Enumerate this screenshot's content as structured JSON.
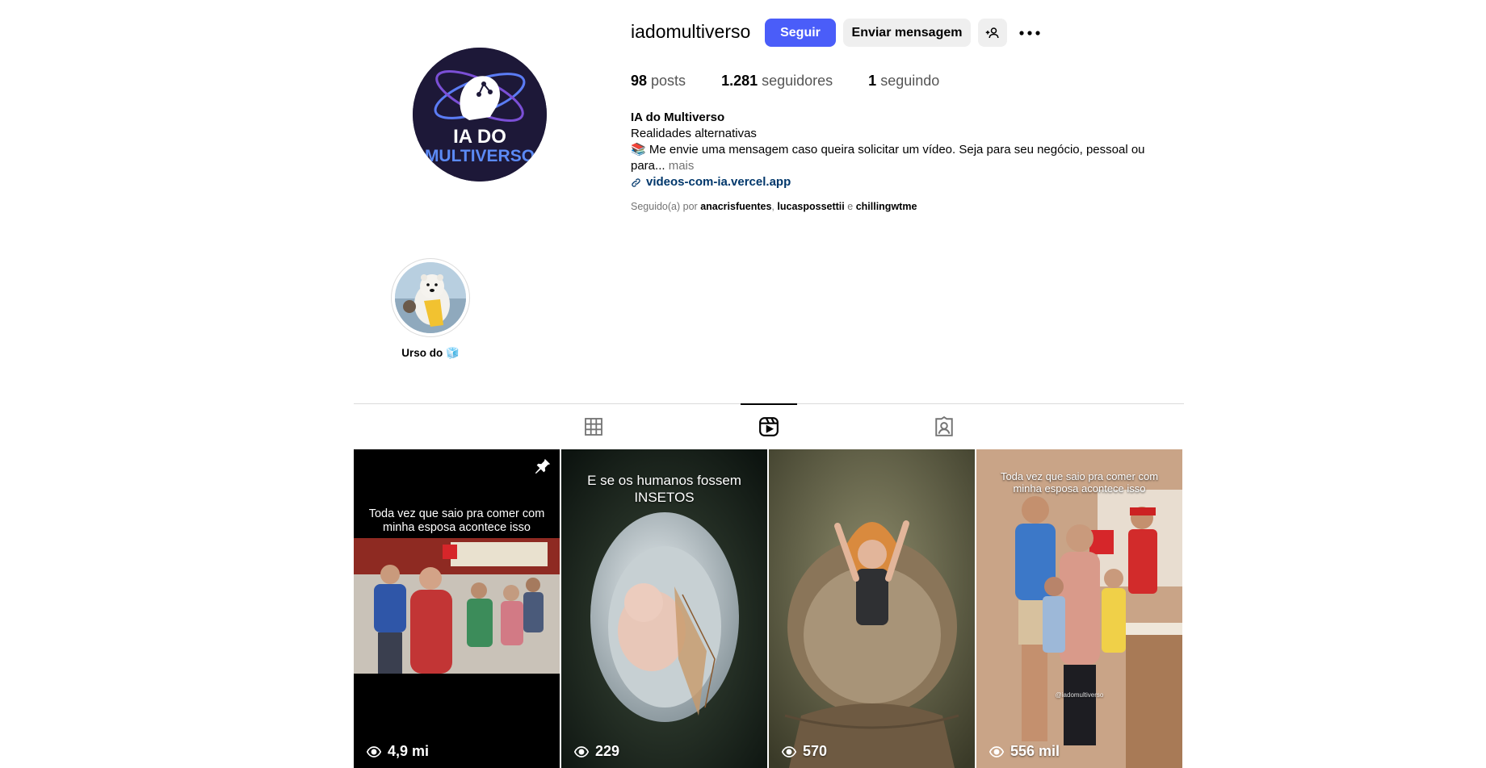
{
  "profile": {
    "username": "iadomultiverso",
    "follow_label": "Seguir",
    "message_label": "Enviar mensagem",
    "avatar_text_top": "IA DO",
    "avatar_text_bottom": "MULTIVERSO"
  },
  "stats": {
    "posts_count": "98",
    "posts_label": "posts",
    "followers_count": "1.281",
    "followers_label": "seguidores",
    "following_count": "1",
    "following_label": "seguindo"
  },
  "bio": {
    "name": "IA do Multiverso",
    "line1": "Realidades alternativas",
    "line2": "📚 Me envie uma mensagem caso queira solicitar um vídeo. Seja para seu negócio, pessoal ou",
    "line3": "para...",
    "more": "mais",
    "link": "videos-com-ia.vercel.app"
  },
  "followed_by": {
    "prefix": "Seguido(a) por",
    "user1": "anacrisfuentes",
    "sep": ",",
    "user2": "lucaspossettii",
    "and": "e",
    "user3": "chillingwtme"
  },
  "highlights": [
    {
      "label": "Urso do 🧊"
    }
  ],
  "tabs": [
    {
      "icon": "grid-icon"
    },
    {
      "icon": "reels-icon"
    },
    {
      "icon": "tagged-icon"
    }
  ],
  "reels": [
    {
      "caption": "Toda vez que saio pra comer com minha esposa acontece isso",
      "views": "4,9 mi",
      "pinned": true
    },
    {
      "caption_line1": "E se os humanos fossem",
      "caption_line2": "INSETOS",
      "views": "229"
    },
    {
      "views": "570"
    },
    {
      "caption": "Toda vez que saio pra comer com minha esposa acontece isso",
      "views": "556 mil",
      "watermark": "@iadomultiverso"
    }
  ],
  "colors": {
    "accent": "#4a5df9",
    "link": "#00376b",
    "muted": "#737373"
  }
}
